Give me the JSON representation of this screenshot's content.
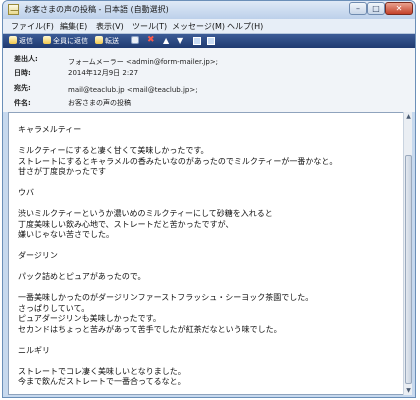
{
  "window": {
    "title": "お客さまの声の投稿 - 日本語 (自動選択)",
    "min_glyph": "–",
    "max_glyph": "□",
    "close_glyph": "✕"
  },
  "menu": {
    "items": [
      {
        "label": "ファイル(F)"
      },
      {
        "label": "編集(E)"
      },
      {
        "label": "表示(V)"
      },
      {
        "label": "ツール(T)"
      },
      {
        "label": "メッセージ(M)"
      },
      {
        "label": "ヘルプ(H)"
      }
    ]
  },
  "toolbar": {
    "reply_label": "返信",
    "reply_all_label": "全員に返信",
    "forward_label": "転送",
    "delete_glyph": "✖",
    "prev_glyph": "▲",
    "next_glyph": "▼"
  },
  "header": {
    "from_label": "差出人:",
    "from_value": "フォームメーラー <admin@form-mailer.jp>;",
    "date_label": "日時:",
    "date_value": "2014年12月9日 2:27",
    "to_label": "宛先:",
    "to_value": "mail@teaclub.jp <mail@teaclub.jp>;",
    "subject_label": "件名:",
    "subject_value": "お客さまの声の投稿"
  },
  "body": {
    "text": "キャラメルティー\n\nミルクティーにすると凄く甘くて美味しかったです。\nストレートにするとキャラメルの香みたいなのがあったのでミルクティーが一番かなと。\n甘さが丁度良かったです\n\nウバ\n\n渋いミルクティーというか濃いめのミルクティーにして砂糖を入れると\n丁度美味しい飲み心地で、ストレートだと苦かったですが、\n嫌いじゃない苦さでした。\n\nダージリン\n\nパック詰めとピュアがあったので。\n\n一番美味しかったのがダージリンファーストフラッシュ・シーヨック茶園でした。\nさっぱりしていて。\nピュアダージリンも美味しかったです。\nセカンドはちょっと苦みがあって苦手でしたが紅茶だなという味でした。\n\nニルギリ\n\nストレートでコレ凄く美味しいとなりました。\n今まで飲んだストレートで一番合ってるなと。"
  },
  "scrollbar": {
    "up_glyph": "▲",
    "down_glyph": "▼"
  }
}
